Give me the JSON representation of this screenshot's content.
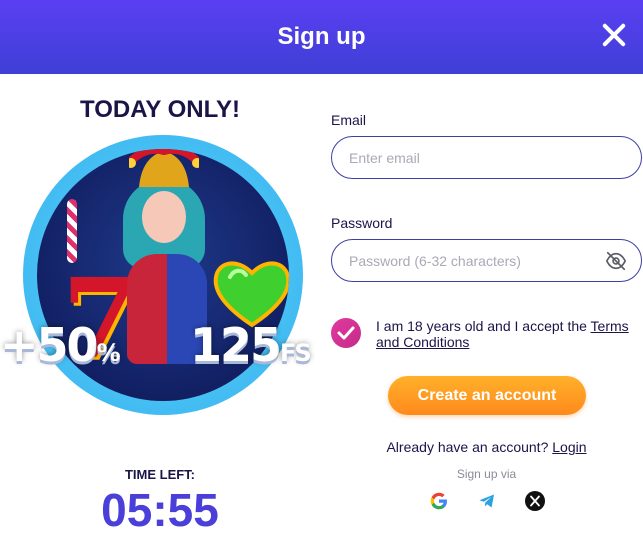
{
  "header": {
    "title": "Sign up"
  },
  "promo": {
    "title": "TODAY ONLY!",
    "bonus_percent": "+50",
    "bonus_percent_sign": "%",
    "free_spins": "125",
    "free_spins_unit": "FS",
    "time_left_label": "TIME LEFT:",
    "timer": "05:55"
  },
  "form": {
    "email_label": "Email",
    "email_placeholder": "Enter email",
    "email_value": "",
    "password_label": "Password",
    "password_placeholder": "Password (6-32 characters)",
    "password_value": "",
    "terms_text": "I am 18 years old and I accept the ",
    "terms_link": "Terms and Conditions",
    "terms_checked": true,
    "create_button": "Create an account",
    "have_account_text": "Already have an account? ",
    "login_link": "Login",
    "signup_via": "Sign up via"
  },
  "social": [
    "google-icon",
    "telegram-icon",
    "x-icon"
  ],
  "colors": {
    "header_gradient_start": "#5a3ff2",
    "header_gradient_end": "#3f3fd6",
    "accent_orange": "#ff8a1c",
    "checkbox_pink": "#e23aa0",
    "timer_blue": "#4a3fd8",
    "text_dark": "#1a1448"
  }
}
